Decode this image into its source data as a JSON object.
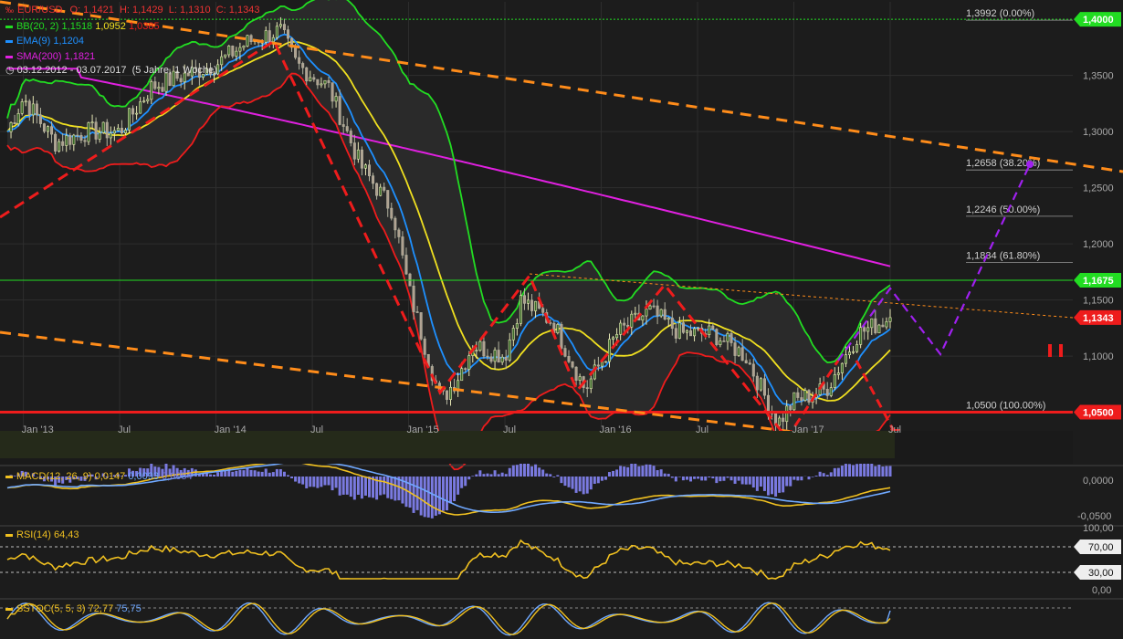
{
  "colors": {
    "bg": "#1c1c1c",
    "grid": "#2e2e2e",
    "axis_text": "#a8a8a8",
    "price_up": "#e6e6b4",
    "price_down": "#b4b4a0",
    "bb": "#22dd22",
    "ema": "#1e90ff",
    "sma": "#e020e0",
    "sma_mid": "#f0e020",
    "trend_red": "#ee1c1c",
    "trend_orange": "#ff8c1a",
    "projection": "#a020f0",
    "macd_hist": "#7a7ae0",
    "macd_line": "#6fa8ff",
    "signal_line": "#f0c020",
    "rsi": "#f0c020",
    "stoch_k": "#6fa8ff",
    "stoch_d": "#f0c020"
  },
  "header": {
    "symbol_line": {
      "symbol": "EUR/USD",
      "ohlc": "O: 1,1421  H: 1,1429  L: 1,1310  C: 1,1343"
    },
    "bb": {
      "label": "BB(20, 2)",
      "upper": "1,1518",
      "mid": "1,0952",
      "lower": "1,0385"
    },
    "ema": {
      "label": "EMA(9)",
      "value": "1,1204"
    },
    "sma": {
      "label": "SMA(200)",
      "value": "1,1821"
    },
    "period": "03.12.2012 - 03.07.2017  (5 Jahre, 1 Woche)"
  },
  "icons": {
    "logo": "chart-logo-icon",
    "clock": "clock-icon",
    "pause": "pause-icon"
  },
  "price_axis": {
    "ticks": [
      "1,3500",
      "1,3000",
      "1,2500",
      "1,2000",
      "1,1500",
      "1,1000"
    ],
    "tags": [
      {
        "text": "1,4000",
        "color": "#22dd22"
      },
      {
        "text": "1,1675",
        "color": "#22dd22"
      },
      {
        "text": "1,1343",
        "color": "#ee1c1c"
      },
      {
        "text": "1,0500",
        "color": "#ee1c1c"
      }
    ]
  },
  "fib_levels": [
    "1,3992 (0.00%)",
    "1,2658 (38.20%)",
    "1,2246 (50.00%)",
    "1,1834 (61.80%)",
    "1,0500 (100.00%)"
  ],
  "time_axis": [
    "Jan '13",
    "Jul",
    "Jan '14",
    "Jul",
    "Jan '15",
    "Jul",
    "Jan '16",
    "Jul",
    "Jan '17",
    "Jul"
  ],
  "macd": {
    "label": "MACD(12, 26, 9)",
    "v1": "0,0147",
    "v2": "0,0093",
    "v3": "0,0054",
    "ticks": [
      "0,0000",
      "-0,0500"
    ]
  },
  "rsi": {
    "label": "RSI(14)",
    "value": "64,43",
    "ticks": [
      "100,00",
      "0,00"
    ],
    "tags": [
      "70,00",
      "30,00"
    ]
  },
  "stoch": {
    "label": "SSTOC(5, 5, 3)",
    "k": "72,77",
    "d": "75,75"
  },
  "chart_data": {
    "type": "candlestick",
    "symbol": "EUR/USD",
    "interval": "weekly",
    "x_range": [
      "03.12.2012",
      "03.07.2017"
    ],
    "y_range": [
      1.035,
      1.405
    ],
    "last": {
      "open": 1.1421,
      "high": 1.1429,
      "low": 1.131,
      "close": 1.1343
    },
    "anchor_prices": [
      [
        "Dec 2012",
        1.3
      ],
      [
        "Jan 2013",
        1.33
      ],
      [
        "Mar 2013",
        1.29
      ],
      [
        "May 2013",
        1.3
      ],
      [
        "Jul 2013",
        1.3
      ],
      [
        "Sep 2013",
        1.34
      ],
      [
        "Nov 2013",
        1.35
      ],
      [
        "Jan 2014",
        1.36
      ],
      [
        "Mar 2014",
        1.38
      ],
      [
        "May 2014",
        1.39
      ],
      [
        "Jun 2014",
        1.36
      ],
      [
        "Aug 2014",
        1.34
      ],
      [
        "Oct 2014",
        1.27
      ],
      [
        "Dec 2014",
        1.23
      ],
      [
        "Jan 2015",
        1.16
      ],
      [
        "Mar 2015",
        1.06
      ],
      [
        "Apr 2015",
        1.08
      ],
      [
        "May 2015",
        1.11
      ],
      [
        "Jul 2015",
        1.1
      ],
      [
        "Aug 2015",
        1.15
      ],
      [
        "Oct 2015",
        1.13
      ],
      [
        "Dec 2015",
        1.07
      ],
      [
        "Feb 2016",
        1.12
      ],
      [
        "Apr 2016",
        1.14
      ],
      [
        "Jun 2016",
        1.12
      ],
      [
        "Aug 2016",
        1.12
      ],
      [
        "Oct 2016",
        1.1
      ],
      [
        "Dec 2016",
        1.04
      ],
      [
        "Jan 2017",
        1.06
      ],
      [
        "Mar 2017",
        1.07
      ],
      [
        "May 2017",
        1.12
      ],
      [
        "Jul 2017",
        1.1343
      ]
    ],
    "indicators": {
      "bb_20_2": {
        "upper": 1.1518,
        "mid": 1.0952,
        "lower": 1.0385
      },
      "ema_9": 1.1204,
      "sma_200": 1.1821,
      "macd_12_26_9": [
        0.0147,
        0.0093,
        0.0054
      ],
      "rsi_14": 64.43,
      "sstoc_5_5_3": [
        72.77,
        75.75
      ]
    },
    "fibonacci": [
      {
        "price": 1.3992,
        "pct": 0.0
      },
      {
        "price": 1.2658,
        "pct": 38.2
      },
      {
        "price": 1.2246,
        "pct": 50.0
      },
      {
        "price": 1.1834,
        "pct": 61.8
      },
      {
        "price": 1.05,
        "pct": 100.0
      }
    ],
    "horizontal_lines": [
      1.4,
      1.1675,
      1.05
    ],
    "rsi_levels": [
      70,
      30
    ]
  }
}
